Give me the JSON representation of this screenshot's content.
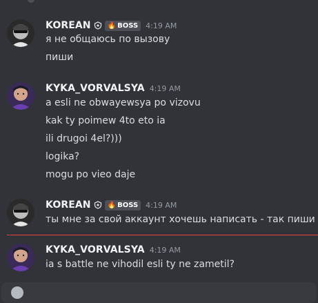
{
  "colors": {
    "background": "#313338",
    "username": "#f2f3f5",
    "timestamp": "#949ba4",
    "message_text": "#dbdee1",
    "badge_bg": "#4e5058",
    "new_messages_divider": "#f23f43"
  },
  "messages": [
    {
      "username": "KOREAN",
      "has_shield_icon": true,
      "badge": "BOSS",
      "badge_icon": "flame-icon",
      "timestamp": "4:19 AM",
      "lines": [
        "я не общаюсь по вызову",
        "пиши"
      ]
    },
    {
      "username": "KYKA_VORVALSYA",
      "has_shield_icon": false,
      "timestamp": "4:19 AM",
      "lines": [
        "a esli ne obwayewsya po vizovu",
        "kak ty poimew 4to eto ia",
        "ili drugoi 4el?)))",
        "logika?",
        "mogu po vieo daje"
      ]
    },
    {
      "username": "KOREAN",
      "has_shield_icon": true,
      "badge": "BOSS",
      "badge_icon": "flame-icon",
      "timestamp": "4:19 AM",
      "lines": [
        "ты мне за свой аккаунт хочешь написать - так пиши"
      ]
    },
    {
      "username": "KYKA_VORVALSYA",
      "has_shield_icon": false,
      "timestamp": "4:19 AM",
      "lines": [
        "ia s battle ne vihodil esli ty ne zametil?"
      ]
    }
  ]
}
